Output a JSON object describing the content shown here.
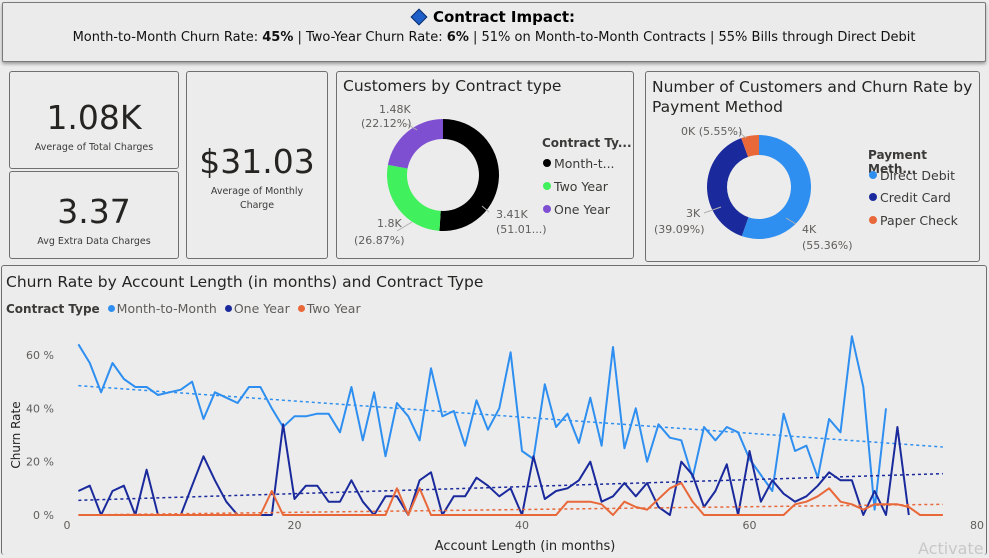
{
  "banner": {
    "title": "Contract Impact:",
    "p1": "Month-to-Month Churn Rate: ",
    "v1": "45%",
    "p2": " | Two-Year Churn Rate: ",
    "v2": "6%",
    "p3": " | 51% on  Month-to-Month Contracts | 55% Bills through Direct Debit"
  },
  "kpis": {
    "total_charges": {
      "value": "1.08K",
      "label": "Average of Total Charges"
    },
    "extra_data": {
      "value": "3.37",
      "label": "Avg Extra Data Charges"
    },
    "monthly_charge": {
      "value": "$31.03",
      "label_1": "Average of Monthly",
      "label_2": "Charge"
    }
  },
  "contract_donut": {
    "title": "Customers by Contract type",
    "legend_title": "Contract Ty...",
    "legend": [
      "Month-t...",
      "Two Year",
      "One Year"
    ],
    "labels": {
      "one_year_1": "1.48K",
      "one_year_2": "(22.12%)",
      "two_year_1": "1.8K",
      "two_year_2": "(26.87%)",
      "month_1": "3.41K",
      "month_2": "(51.01...)"
    }
  },
  "payment_donut": {
    "title_1": "Number of Customers and Churn Rate by",
    "title_2": "Payment Method",
    "legend_title": "Payment Meth...",
    "legend": [
      "Direct Debit",
      "Credit Card",
      "Paper Check"
    ],
    "labels": {
      "paper_1": "0K (5.55%)",
      "credit_1": "3K",
      "credit_2": "(39.09%)",
      "direct_1": "4K",
      "direct_2": "(55.36%)"
    }
  },
  "line_panel": {
    "title": "Churn Rate by Account Length (in months) and Contract Type",
    "legend_title": "Contract Type",
    "watermark": "Activate"
  },
  "colors": {
    "month_to_month": "#2e8ff0",
    "one_year": "#1a2a9c",
    "two_year": "#e8683a",
    "contract_month": "#000000",
    "contract_two": "#41f05d",
    "contract_one": "#7e4fd1",
    "pay_direct": "#2e8ff0",
    "pay_credit": "#1a2a9c",
    "pay_paper": "#e8683a"
  },
  "chart_data": [
    {
      "type": "pie",
      "title": "Customers by Contract type",
      "categories": [
        "Month-to-Month",
        "Two Year",
        "One Year"
      ],
      "values": [
        3.41,
        1.8,
        1.48
      ],
      "percents": [
        51.01,
        26.87,
        22.12
      ],
      "legend": "right"
    },
    {
      "type": "pie",
      "title": "Number of Customers and Churn Rate by Payment Method",
      "categories": [
        "Direct Debit",
        "Credit Card",
        "Paper Check"
      ],
      "values": [
        4,
        3,
        0
      ],
      "percents": [
        55.36,
        39.09,
        5.55
      ],
      "legend": "right"
    },
    {
      "type": "line",
      "title": "Churn Rate by Account Length (in months) and Contract Type",
      "xlabel": "Account Length (in months)",
      "ylabel": "Churn Rate",
      "xlim": [
        0,
        80
      ],
      "ylim": [
        0,
        70
      ],
      "xticks": [
        0,
        20,
        40,
        60,
        80
      ],
      "yticks": [
        0,
        20,
        40,
        60
      ],
      "ytick_labels": [
        "0 %",
        "20 %",
        "40 %",
        "60 %"
      ],
      "grid": false,
      "legend": "top-left",
      "series": [
        {
          "name": "Month-to-Month",
          "x": [
            1,
            2,
            3,
            4,
            5,
            6,
            7,
            8,
            9,
            10,
            11,
            12,
            13,
            14,
            15,
            16,
            17,
            18,
            19,
            20,
            21,
            22,
            23,
            24,
            25,
            26,
            27,
            28,
            29,
            30,
            31,
            32,
            33,
            34,
            35,
            36,
            37,
            38,
            39,
            40,
            41,
            42,
            43,
            44,
            45,
            46,
            47,
            48,
            49,
            50,
            51,
            52,
            53,
            54,
            55,
            56,
            57,
            58,
            59,
            60,
            61,
            62,
            63,
            64,
            65,
            66,
            67,
            68,
            69,
            70,
            71,
            72
          ],
          "y": [
            64,
            57,
            46,
            57,
            51,
            48,
            48,
            45,
            46,
            47,
            50,
            36,
            46,
            44,
            42,
            48,
            48,
            40,
            33,
            37,
            37,
            38,
            38,
            31,
            48,
            28,
            46,
            22,
            42,
            37,
            28,
            55,
            37,
            39,
            26,
            43,
            32,
            40,
            61,
            24,
            21,
            49,
            33,
            38,
            27,
            44,
            26,
            63,
            25,
            40,
            20,
            34,
            29,
            28,
            14,
            33,
            28,
            33,
            31,
            21,
            15,
            9,
            38,
            24,
            26,
            14,
            36,
            31,
            67,
            48,
            2,
            40
          ],
          "trend": [
            48.5,
            25.5
          ]
        },
        {
          "name": "One Year",
          "x": [
            1,
            2,
            3,
            4,
            5,
            6,
            7,
            8,
            9,
            10,
            11,
            12,
            13,
            14,
            15,
            16,
            17,
            18,
            19,
            20,
            21,
            22,
            23,
            24,
            25,
            26,
            27,
            28,
            29,
            30,
            31,
            32,
            33,
            34,
            35,
            36,
            37,
            38,
            39,
            40,
            41,
            42,
            43,
            44,
            45,
            46,
            47,
            48,
            49,
            50,
            51,
            52,
            53,
            54,
            55,
            56,
            57,
            58,
            59,
            60,
            61,
            62,
            63,
            64,
            65,
            66,
            67,
            68,
            69,
            70,
            71,
            72,
            73,
            74
          ],
          "y": [
            9,
            11,
            0,
            9,
            11,
            0,
            17,
            0,
            0,
            0,
            11,
            22,
            13,
            5,
            0,
            0,
            0,
            0,
            34,
            6,
            11,
            11,
            5,
            5,
            13,
            5,
            0,
            7,
            7,
            0,
            13,
            16,
            0,
            7,
            7,
            14,
            11,
            7,
            10,
            0,
            22,
            6,
            9,
            10,
            13,
            20,
            5,
            7,
            12,
            7,
            12,
            3,
            0,
            20,
            15,
            3,
            9,
            19,
            0,
            24,
            5,
            13,
            8,
            5,
            7,
            11,
            16,
            13,
            13,
            0,
            9,
            0,
            33,
            0
          ],
          "trend": [
            5.5,
            15.5
          ]
        },
        {
          "name": "Two Year",
          "x": [
            1,
            2,
            3,
            4,
            5,
            6,
            7,
            8,
            9,
            10,
            11,
            12,
            13,
            14,
            15,
            16,
            17,
            18,
            19,
            20,
            21,
            22,
            23,
            24,
            25,
            26,
            27,
            28,
            29,
            30,
            31,
            32,
            33,
            34,
            35,
            36,
            37,
            38,
            39,
            40,
            41,
            42,
            43,
            44,
            45,
            46,
            47,
            48,
            49,
            50,
            51,
            52,
            53,
            54,
            55,
            56,
            57,
            58,
            59,
            60,
            61,
            62,
            63,
            64,
            65,
            66,
            67,
            68,
            69,
            70,
            71,
            72,
            73,
            74,
            75,
            76,
            77
          ],
          "y": [
            0,
            0,
            0,
            0,
            0,
            0,
            0,
            0,
            0,
            0,
            0,
            0,
            0,
            0,
            0,
            0,
            0,
            9,
            0,
            0,
            0,
            0,
            0,
            0,
            0,
            0,
            0,
            0,
            10,
            0,
            10,
            0,
            0,
            0,
            0,
            0,
            0,
            0,
            0,
            0,
            0,
            0,
            0,
            5,
            5,
            5,
            4,
            0,
            5,
            3,
            2,
            6,
            10,
            12,
            5,
            0,
            0,
            0,
            0,
            0,
            0,
            0,
            0,
            4,
            5,
            7,
            10,
            5,
            4,
            2,
            4,
            4,
            4,
            3,
            0,
            0,
            0
          ],
          "trend": [
            0,
            4
          ]
        }
      ]
    }
  ]
}
